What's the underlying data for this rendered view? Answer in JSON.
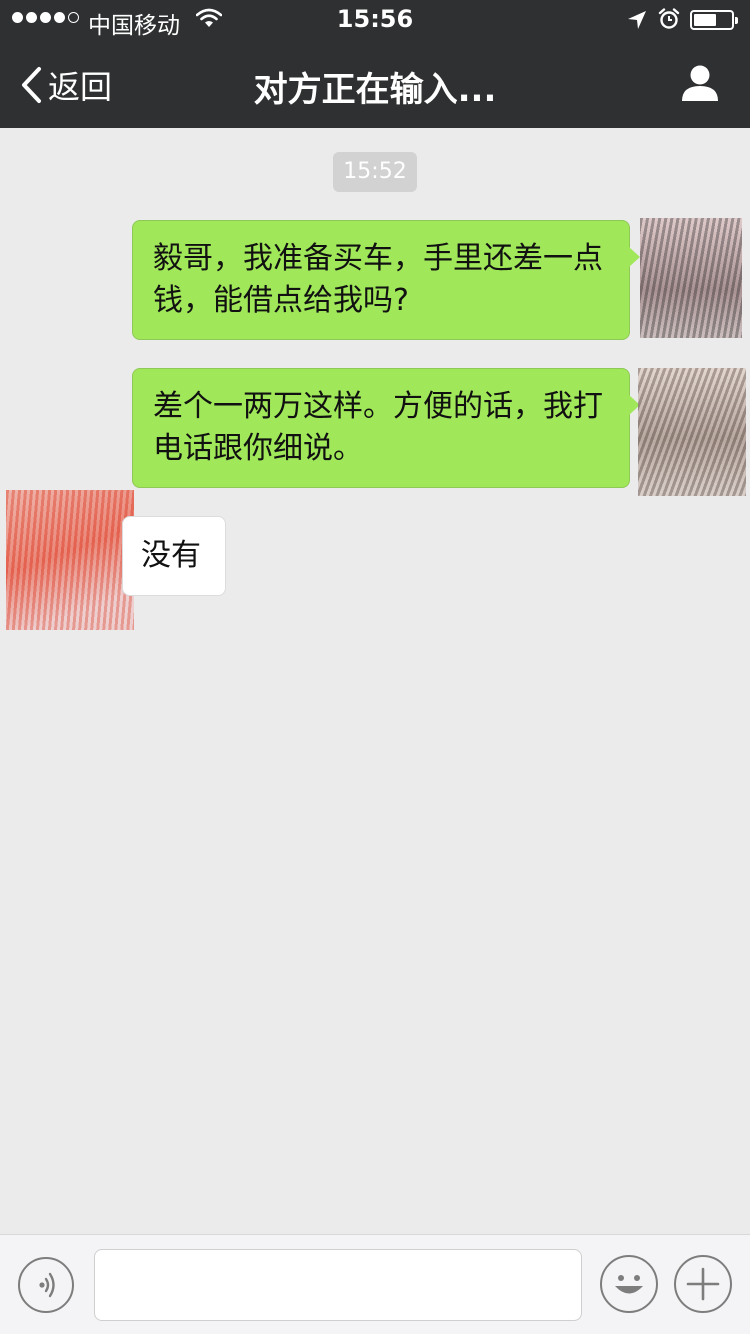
{
  "status_bar": {
    "carrier": "中国移动",
    "time": "15:56",
    "signal_bars_filled": 4,
    "signal_bars_total": 5,
    "battery_level": 0.55
  },
  "nav": {
    "back_label": "返回",
    "title": "对方正在输入..."
  },
  "chat": {
    "timestamp": "15:52",
    "messages": [
      {
        "direction": "out",
        "text": "毅哥，我准备买车，手里还差一点钱，能借点给我吗?"
      },
      {
        "direction": "out",
        "text": "差个一两万这样。方便的话，我打电话跟你细说。"
      },
      {
        "direction": "in",
        "text": "没有"
      }
    ]
  },
  "input_bar": {
    "message_value": "",
    "icons": [
      "voice-icon",
      "emoji-icon",
      "plus-icon"
    ]
  },
  "colors": {
    "nav_background": "#2e3032",
    "chat_background": "#ebebeb",
    "outgoing_bubble": "#a0e75a",
    "incoming_bubble": "#ffffff",
    "timestamp_background": "#d2d2d2"
  }
}
